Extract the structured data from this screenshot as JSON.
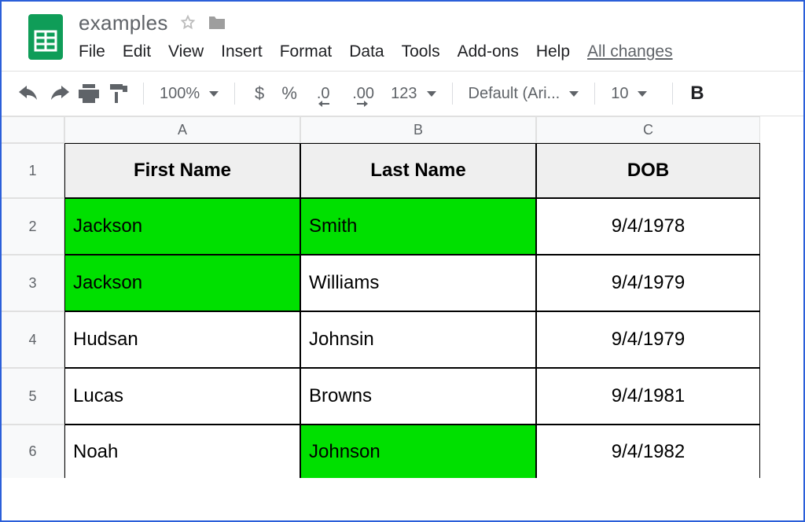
{
  "document": {
    "title": "examples"
  },
  "menus": {
    "file": "File",
    "edit": "Edit",
    "view": "View",
    "insert": "Insert",
    "format": "Format",
    "data": "Data",
    "tools": "Tools",
    "addons": "Add-ons",
    "help": "Help",
    "all_changes": "All changes"
  },
  "toolbar": {
    "zoom": "100%",
    "currency": "$",
    "percent": "%",
    "dec_decrease": ".0",
    "dec_increase": ".00",
    "more_formats": "123",
    "font_name": "Default (Ari...",
    "font_size": "10",
    "bold": "B"
  },
  "columns": {
    "A": "A",
    "B": "B",
    "C": "C"
  },
  "rows": {
    "r1": "1",
    "r2": "2",
    "r3": "3",
    "r4": "4",
    "r5": "5",
    "r6": "6"
  },
  "headers": {
    "first_name": "First Name",
    "last_name": "Last Name",
    "dob": "DOB"
  },
  "data": [
    {
      "first": "Jackson",
      "last": "Smith",
      "dob": "9/4/1978",
      "hl_first": true,
      "hl_last": true
    },
    {
      "first": "Jackson",
      "last": "Williams",
      "dob": "9/4/1979",
      "hl_first": true,
      "hl_last": false
    },
    {
      "first": "Hudsan",
      "last": "Johnsin",
      "dob": "9/4/1979",
      "hl_first": false,
      "hl_last": false
    },
    {
      "first": "Lucas",
      "last": "Browns",
      "dob": "9/4/1981",
      "hl_first": false,
      "hl_last": false
    },
    {
      "first": "Noah",
      "last": "Johnson",
      "dob": "9/4/1982",
      "hl_first": false,
      "hl_last": true
    }
  ]
}
